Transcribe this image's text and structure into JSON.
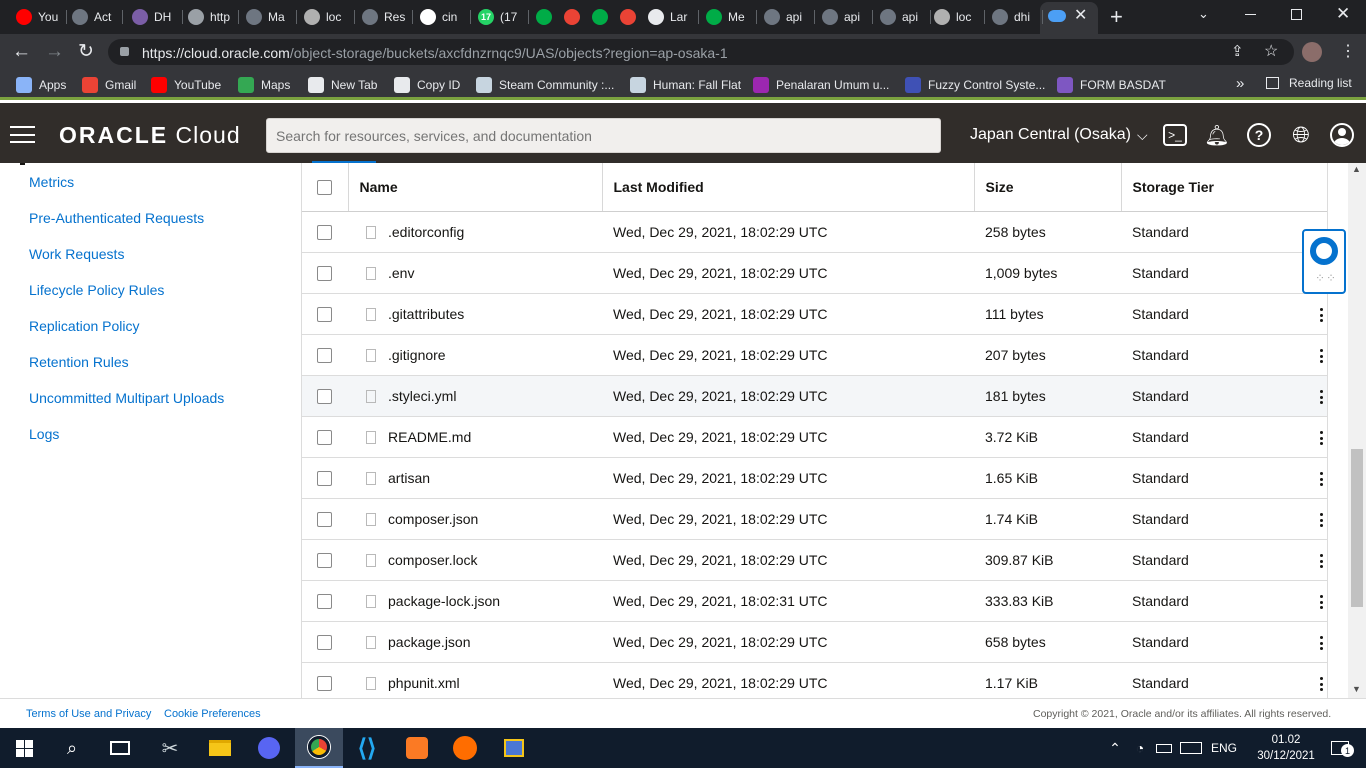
{
  "browser": {
    "tabs": [
      {
        "title": "You",
        "icon": "youtube-icon",
        "color": "#ff0000"
      },
      {
        "title": "Act",
        "icon": "github-icon",
        "color": "#6e7681"
      },
      {
        "title": "DH",
        "icon": "emblem-icon",
        "color": "#7b5ea7"
      },
      {
        "title": "http",
        "icon": "page-icon",
        "color": "#9aa0a6"
      },
      {
        "title": "Ma",
        "icon": "github-icon",
        "color": "#6e7681"
      },
      {
        "title": "loc",
        "icon": "xampp-icon",
        "color": "#b0b0b0"
      },
      {
        "title": "Res",
        "icon": "github-icon",
        "color": "#6e7681"
      },
      {
        "title": "cin",
        "icon": "google-icon",
        "color": "#ffffff"
      },
      {
        "title": "(17",
        "icon": "whatsapp-icon",
        "color": "#25d366",
        "badge": "17"
      },
      {
        "title": "",
        "icon": "meet-icon",
        "color": "#00ac47"
      },
      {
        "title": "",
        "icon": "record-icon",
        "color": "#ea4335"
      },
      {
        "title": "",
        "icon": "meet-icon",
        "color": "#00ac47"
      },
      {
        "title": "",
        "icon": "record-icon",
        "color": "#ea4335"
      },
      {
        "title": "Lar",
        "icon": "globe-icon",
        "color": "#e8eaed"
      },
      {
        "title": "Me",
        "icon": "meet-icon",
        "color": "#00ac47"
      },
      {
        "title": "api",
        "icon": "github-icon",
        "color": "#6e7681"
      },
      {
        "title": "api",
        "icon": "github-icon",
        "color": "#6e7681"
      },
      {
        "title": "api",
        "icon": "github-icon",
        "color": "#6e7681"
      },
      {
        "title": "loc",
        "icon": "xampp-icon",
        "color": "#b0b0b0"
      },
      {
        "title": "dhi",
        "icon": "github-icon",
        "color": "#6e7681"
      },
      {
        "title": "",
        "icon": "cloud-icon",
        "color": "#4c9ff5"
      }
    ],
    "url_host": "https://cloud.oracle.com",
    "url_path": "/object-storage/buckets/axcfdnzrnqc9/UAS/objects?region=ap-osaka-1",
    "bookmarks": [
      {
        "label": "Apps",
        "icon": "apps-grid-icon",
        "color": "#8ab4f8"
      },
      {
        "label": "Gmail",
        "icon": "gmail-icon",
        "color": "#ea4335"
      },
      {
        "label": "YouTube",
        "icon": "youtube-icon",
        "color": "#ff0000"
      },
      {
        "label": "Maps",
        "icon": "maps-icon",
        "color": "#34a853"
      },
      {
        "label": "New Tab",
        "icon": "globe-icon",
        "color": "#e8eaed"
      },
      {
        "label": "Copy ID",
        "icon": "globe-icon",
        "color": "#e8eaed"
      },
      {
        "label": "Steam Community :...",
        "icon": "steam-icon",
        "color": "#c7d5e0"
      },
      {
        "label": "Human: Fall Flat",
        "icon": "steam-icon",
        "color": "#c7d5e0"
      },
      {
        "label": "Penalaran Umum u...",
        "icon": "zenius-icon",
        "color": "#9c27b0"
      },
      {
        "label": "Fuzzy Control Syste...",
        "icon": "fuzzy-icon",
        "color": "#3f51b5"
      },
      {
        "label": "FORM BASDAT",
        "icon": "form-icon",
        "color": "#7e57c2"
      }
    ],
    "overflow_label": "»",
    "reading_list": "Reading list"
  },
  "oracle": {
    "logo_bold": "ORACLE",
    "logo_light": "Cloud",
    "search_placeholder": "Search for resources, services, and documentation",
    "region": "Japan Central (Osaka)"
  },
  "sidebar": {
    "links": [
      "Metrics",
      "Pre-Authenticated Requests",
      "Work Requests",
      "Lifecycle Policy Rules",
      "Replication Policy",
      "Retention Rules",
      "Uncommitted Multipart Uploads",
      "Logs"
    ]
  },
  "table": {
    "columns": [
      "Name",
      "Last Modified",
      "Size",
      "Storage Tier"
    ],
    "rows": [
      {
        "name": ".editorconfig",
        "modified": "Wed, Dec 29, 2021, 18:02:29 UTC",
        "size": "258 bytes",
        "tier": "Standard"
      },
      {
        "name": ".env",
        "modified": "Wed, Dec 29, 2021, 18:02:29 UTC",
        "size": "1,009 bytes",
        "tier": "Standard"
      },
      {
        "name": ".gitattributes",
        "modified": "Wed, Dec 29, 2021, 18:02:29 UTC",
        "size": "111 bytes",
        "tier": "Standard"
      },
      {
        "name": ".gitignore",
        "modified": "Wed, Dec 29, 2021, 18:02:29 UTC",
        "size": "207 bytes",
        "tier": "Standard"
      },
      {
        "name": ".styleci.yml",
        "modified": "Wed, Dec 29, 2021, 18:02:29 UTC",
        "size": "181 bytes",
        "tier": "Standard"
      },
      {
        "name": "README.md",
        "modified": "Wed, Dec 29, 2021, 18:02:29 UTC",
        "size": "3.72 KiB",
        "tier": "Standard"
      },
      {
        "name": "artisan",
        "modified": "Wed, Dec 29, 2021, 18:02:29 UTC",
        "size": "1.65 KiB",
        "tier": "Standard"
      },
      {
        "name": "composer.json",
        "modified": "Wed, Dec 29, 2021, 18:02:29 UTC",
        "size": "1.74 KiB",
        "tier": "Standard"
      },
      {
        "name": "composer.lock",
        "modified": "Wed, Dec 29, 2021, 18:02:29 UTC",
        "size": "309.87 KiB",
        "tier": "Standard"
      },
      {
        "name": "package-lock.json",
        "modified": "Wed, Dec 29, 2021, 18:02:31 UTC",
        "size": "333.83 KiB",
        "tier": "Standard"
      },
      {
        "name": "package.json",
        "modified": "Wed, Dec 29, 2021, 18:02:29 UTC",
        "size": "658 bytes",
        "tier": "Standard"
      },
      {
        "name": "phpunit.xml",
        "modified": "Wed, Dec 29, 2021, 18:02:29 UTC",
        "size": "1.17 KiB",
        "tier": "Standard"
      }
    ]
  },
  "footer": {
    "terms": "Terms of Use and Privacy",
    "cookies": "Cookie Preferences",
    "copyright": "Copyright © 2021, Oracle and/or its affiliates. All rights reserved."
  },
  "taskbar": {
    "language": "ENG",
    "time": "01.02",
    "date": "30/12/2021",
    "notification_count": "1"
  }
}
